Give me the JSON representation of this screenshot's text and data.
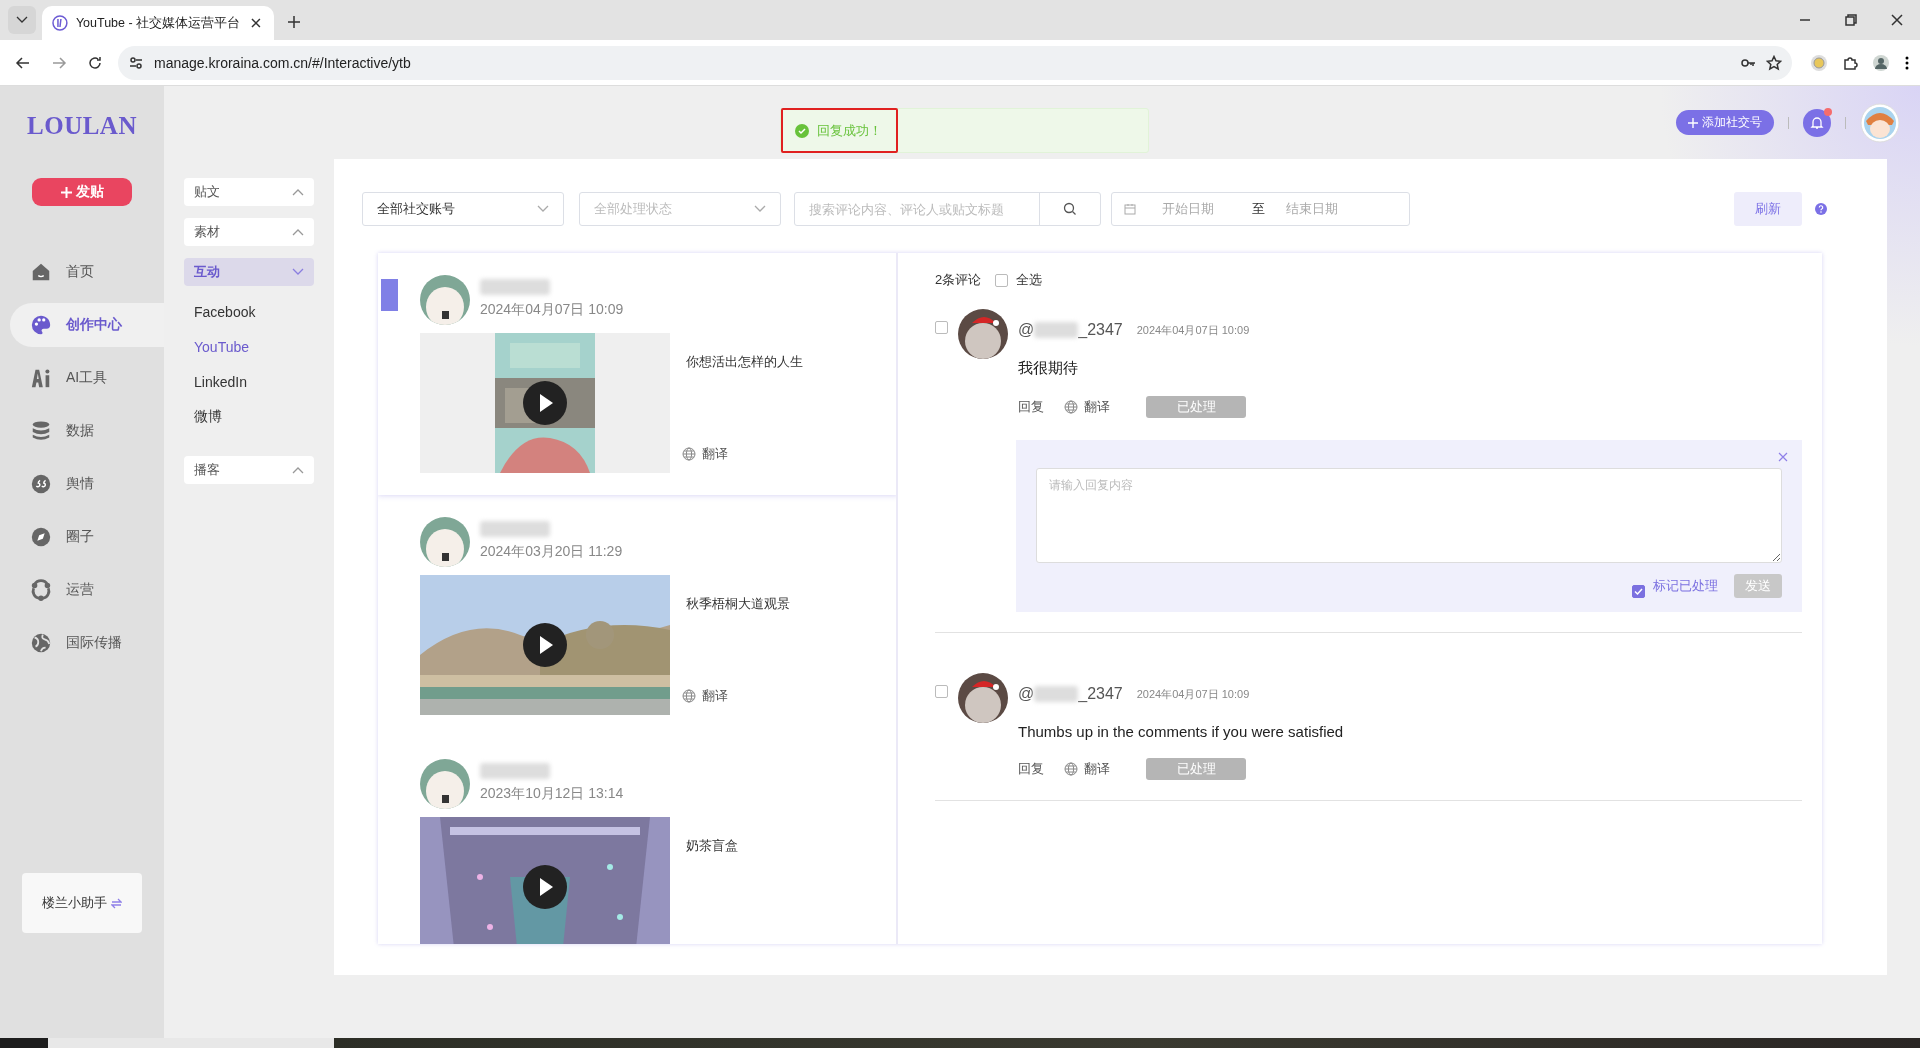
{
  "browser": {
    "tab_title": "YouTube - 社交媒体运营平台",
    "url": "manage.kroraina.com.cn/#/Interactive/ytb"
  },
  "toast": {
    "message": "回复成功！",
    "highlighted": true
  },
  "header": {
    "add_account": "添加社交号",
    "unread": true
  },
  "sidebar": {
    "logo": "LOULAN",
    "post_button": "发贴",
    "assistant": "楼兰小助手",
    "items": [
      {
        "label": "首页",
        "selected": false
      },
      {
        "label": "创作中心",
        "selected": true
      },
      {
        "label": "AI工具",
        "selected": false
      },
      {
        "label": "数据",
        "selected": false
      },
      {
        "label": "舆情",
        "selected": false
      },
      {
        "label": "圈子",
        "selected": false
      },
      {
        "label": "运营",
        "selected": false
      },
      {
        "label": "国际传播",
        "selected": false
      }
    ]
  },
  "submenu": [
    {
      "label": "贴文",
      "expanded": false,
      "selected": false
    },
    {
      "label": "素材",
      "expanded": false,
      "selected": false
    },
    {
      "label": "互动",
      "expanded": true,
      "selected": true,
      "children": [
        {
          "label": "Facebook",
          "selected": false
        },
        {
          "label": "YouTube",
          "selected": true
        },
        {
          "label": "LinkedIn",
          "selected": false
        },
        {
          "label": "微博",
          "selected": false
        }
      ]
    },
    {
      "label": "播客",
      "expanded": false,
      "selected": false
    }
  ],
  "filters": {
    "account": "全部社交账号",
    "status_placeholder": "全部处理状态",
    "search_placeholder": "搜索评论内容、评论人或贴文标题",
    "start_date": "开始日期",
    "separator": "至",
    "end_date": "结束日期",
    "refresh": "刷新"
  },
  "posts": [
    {
      "date": "2024年04月07日 10:09",
      "title": "你想活出怎样的人生",
      "translate": "翻译",
      "selected": true
    },
    {
      "date": "2024年03月20日 11:29",
      "title": "秋季梧桐大道观景",
      "translate": "翻译",
      "selected": false
    },
    {
      "date": "2023年10月12日 13:14",
      "title": "奶茶盲盒",
      "selected": false
    }
  ],
  "comments": {
    "count": "2条评论",
    "select_all": "全选",
    "select_all_checked": false,
    "items": [
      {
        "checked": false,
        "author_prefix": "@",
        "author_suffix": "_2347",
        "date": "2024年04月07日 10:09",
        "text": "我很期待",
        "reply": "回复",
        "translate": "翻译",
        "status": "已处理",
        "reply_box": {
          "placeholder": "请输入回复内容",
          "mark_label": "标记已处理",
          "mark_checked": true,
          "send": "发送"
        }
      },
      {
        "checked": false,
        "author_prefix": "@",
        "author_suffix": "_2347",
        "date": "2024年04月07日 10:09",
        "text": "Thumbs up in the comments if you were satisfied",
        "reply": "回复",
        "translate": "翻译",
        "status": "已处理"
      }
    ]
  }
}
